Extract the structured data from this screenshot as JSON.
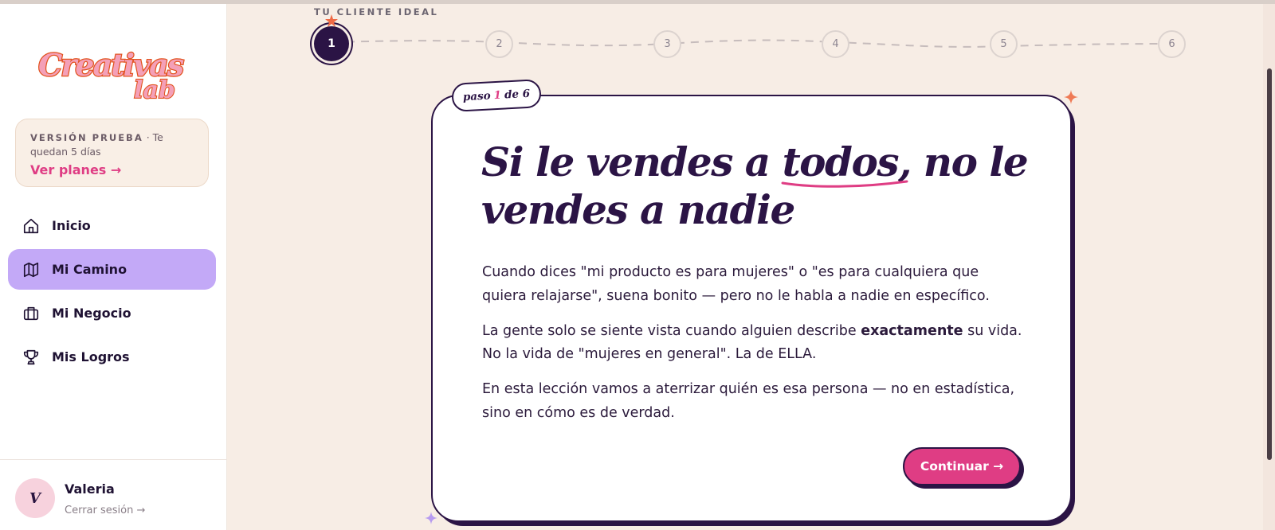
{
  "brand": {
    "logo_line1": "Creativas",
    "logo_line2": "lab"
  },
  "trial": {
    "tag": "VERSIÓN PRUEBA",
    "remaining": "· Te quedan 5 días",
    "link": "Ver planes →"
  },
  "nav": {
    "items": [
      {
        "label": "Inicio",
        "icon": "home-icon",
        "active": false
      },
      {
        "label": "Mi Camino",
        "icon": "map-icon",
        "active": true
      },
      {
        "label": "Mi Negocio",
        "icon": "briefcase-icon",
        "active": false
      },
      {
        "label": "Mis Logros",
        "icon": "trophy-icon",
        "active": false
      }
    ]
  },
  "user": {
    "initial": "V",
    "name": "Valeria",
    "logout": "Cerrar sesión →"
  },
  "steps": {
    "title": "TU CLIENTE IDEAL",
    "items": [
      "1",
      "2",
      "3",
      "4",
      "5",
      "6"
    ],
    "current": 1
  },
  "card": {
    "badge_prefix": "paso",
    "badge_number": "1",
    "badge_suffix": "de 6",
    "headline_part1": "Si le vendes a ",
    "headline_highlight": "todos",
    "headline_part2": ", no le vendes a nadie",
    "p1": "Cuando dices \"mi producto es para mujeres\" o \"es para cualquiera que quiera relajarse\", suena bonito — pero no le habla a nadie en específico.",
    "p2_before": "La gente solo se siente vista cuando alguien describe ",
    "p2_bold": "exactamente",
    "p2_after": " su vida. No la vida de \"mujeres en general\". La de ELLA.",
    "p3": "En esta lección vamos a aterrizar quién es esa persona — no en estadística, sino en cómo es de verdad.",
    "button": "Continuar →"
  },
  "colors": {
    "accent": "#df3d84",
    "ink": "#2b1445",
    "active_nav": "#c3a9f7",
    "background": "#f7ede5"
  }
}
